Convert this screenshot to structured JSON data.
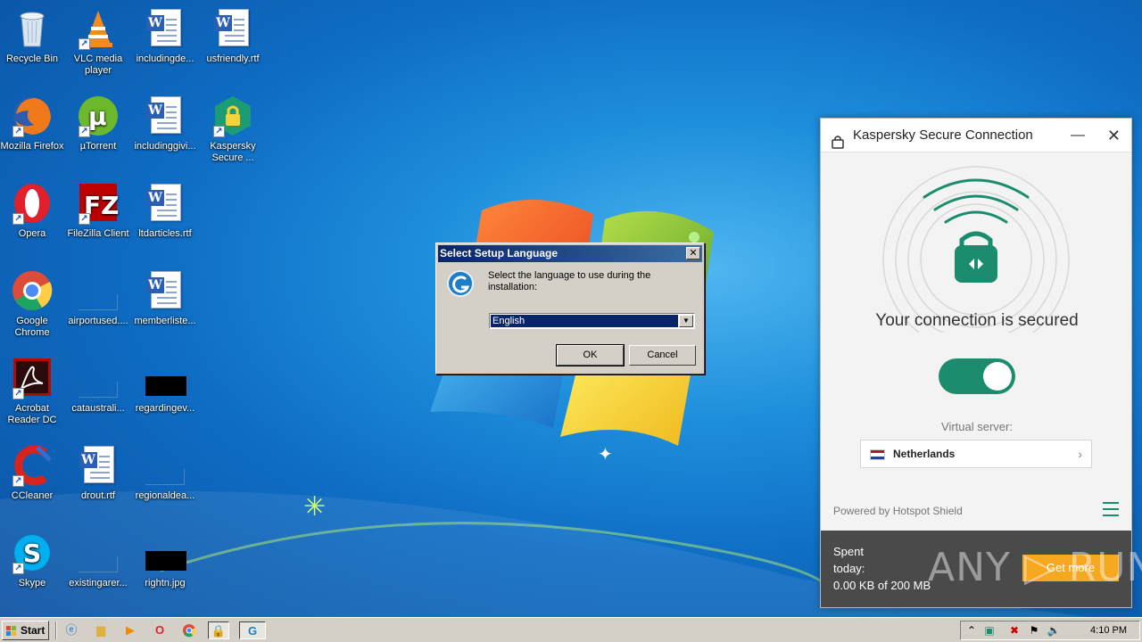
{
  "desktop": {
    "icons": [
      {
        "label": "Recycle Bin",
        "icon": "recycle-bin-icon"
      },
      {
        "label": "VLC media player",
        "icon": "vlc-icon"
      },
      {
        "label": "includingde...",
        "icon": "word-document-icon"
      },
      {
        "label": "usfriendly.rtf",
        "icon": "word-document-icon"
      },
      {
        "label": "Mozilla Firefox",
        "icon": "firefox-icon"
      },
      {
        "label": "µTorrent",
        "icon": "utorrent-icon"
      },
      {
        "label": "includinggivi...",
        "icon": "word-document-icon"
      },
      {
        "label": "Kaspersky Secure ...",
        "icon": "kaspersky-secure-connection-icon"
      },
      {
        "label": "Opera",
        "icon": "opera-icon"
      },
      {
        "label": "FileZilla Client",
        "icon": "filezilla-icon"
      },
      {
        "label": "ltdarticles.rtf",
        "icon": "word-document-icon"
      },
      {
        "label": "Google Chrome",
        "icon": "chrome-icon"
      },
      {
        "label": "airportused....",
        "icon": "file-thumbnail-icon"
      },
      {
        "label": "memberliste...",
        "icon": "word-document-icon"
      },
      {
        "label": "Acrobat Reader DC",
        "icon": "acrobat-icon"
      },
      {
        "label": "cataustrali...",
        "icon": "file-thumbnail-icon"
      },
      {
        "label": "regardingev...",
        "icon": "image-thumbnail-icon"
      },
      {
        "label": "CCleaner",
        "icon": "ccleaner-icon"
      },
      {
        "label": "drout.rtf",
        "icon": "word-document-icon"
      },
      {
        "label": "regionaldea...",
        "icon": "file-thumbnail-icon"
      },
      {
        "label": "Skype",
        "icon": "skype-icon"
      },
      {
        "label": "existingarer...",
        "icon": "file-thumbnail-icon"
      },
      {
        "label": "rightn.jpg",
        "icon": "image-thumbnail-icon"
      }
    ]
  },
  "dialog": {
    "title": "Select Setup Language",
    "close_label": "✕",
    "message": "Select the language to use during the installation:",
    "language_selected": "English",
    "ok_label": "OK",
    "cancel_label": "Cancel"
  },
  "kaspersky": {
    "title": "Kaspersky Secure Connection",
    "minimize_label": "—",
    "close_label": "✕",
    "status": "Your connection is secured",
    "toggle_on": true,
    "virtual_server_label": "Virtual server:",
    "server_name": "Netherlands",
    "powered_by": "Powered by Hotspot Shield",
    "spent_line1": "Spent",
    "spent_line2": "today:",
    "spent_amount": "0.00 KB of 200 MB",
    "get_more_label": "Get more",
    "accent_color": "#1b8c6d"
  },
  "watermark": {
    "text": "ANY ▷ RUN"
  },
  "taskbar": {
    "start_label": "Start",
    "clock": "4:10 PM",
    "quicklaunch": [
      "ie-icon",
      "explorer-icon",
      "media-player-icon",
      "opera-icon",
      "chrome-icon",
      "kaspersky-icon",
      "setup-icon"
    ],
    "tray": [
      "show-hidden-icon",
      "kaspersky-tray-icon",
      "network-error-icon",
      "action-center-icon",
      "volume-icon"
    ]
  }
}
